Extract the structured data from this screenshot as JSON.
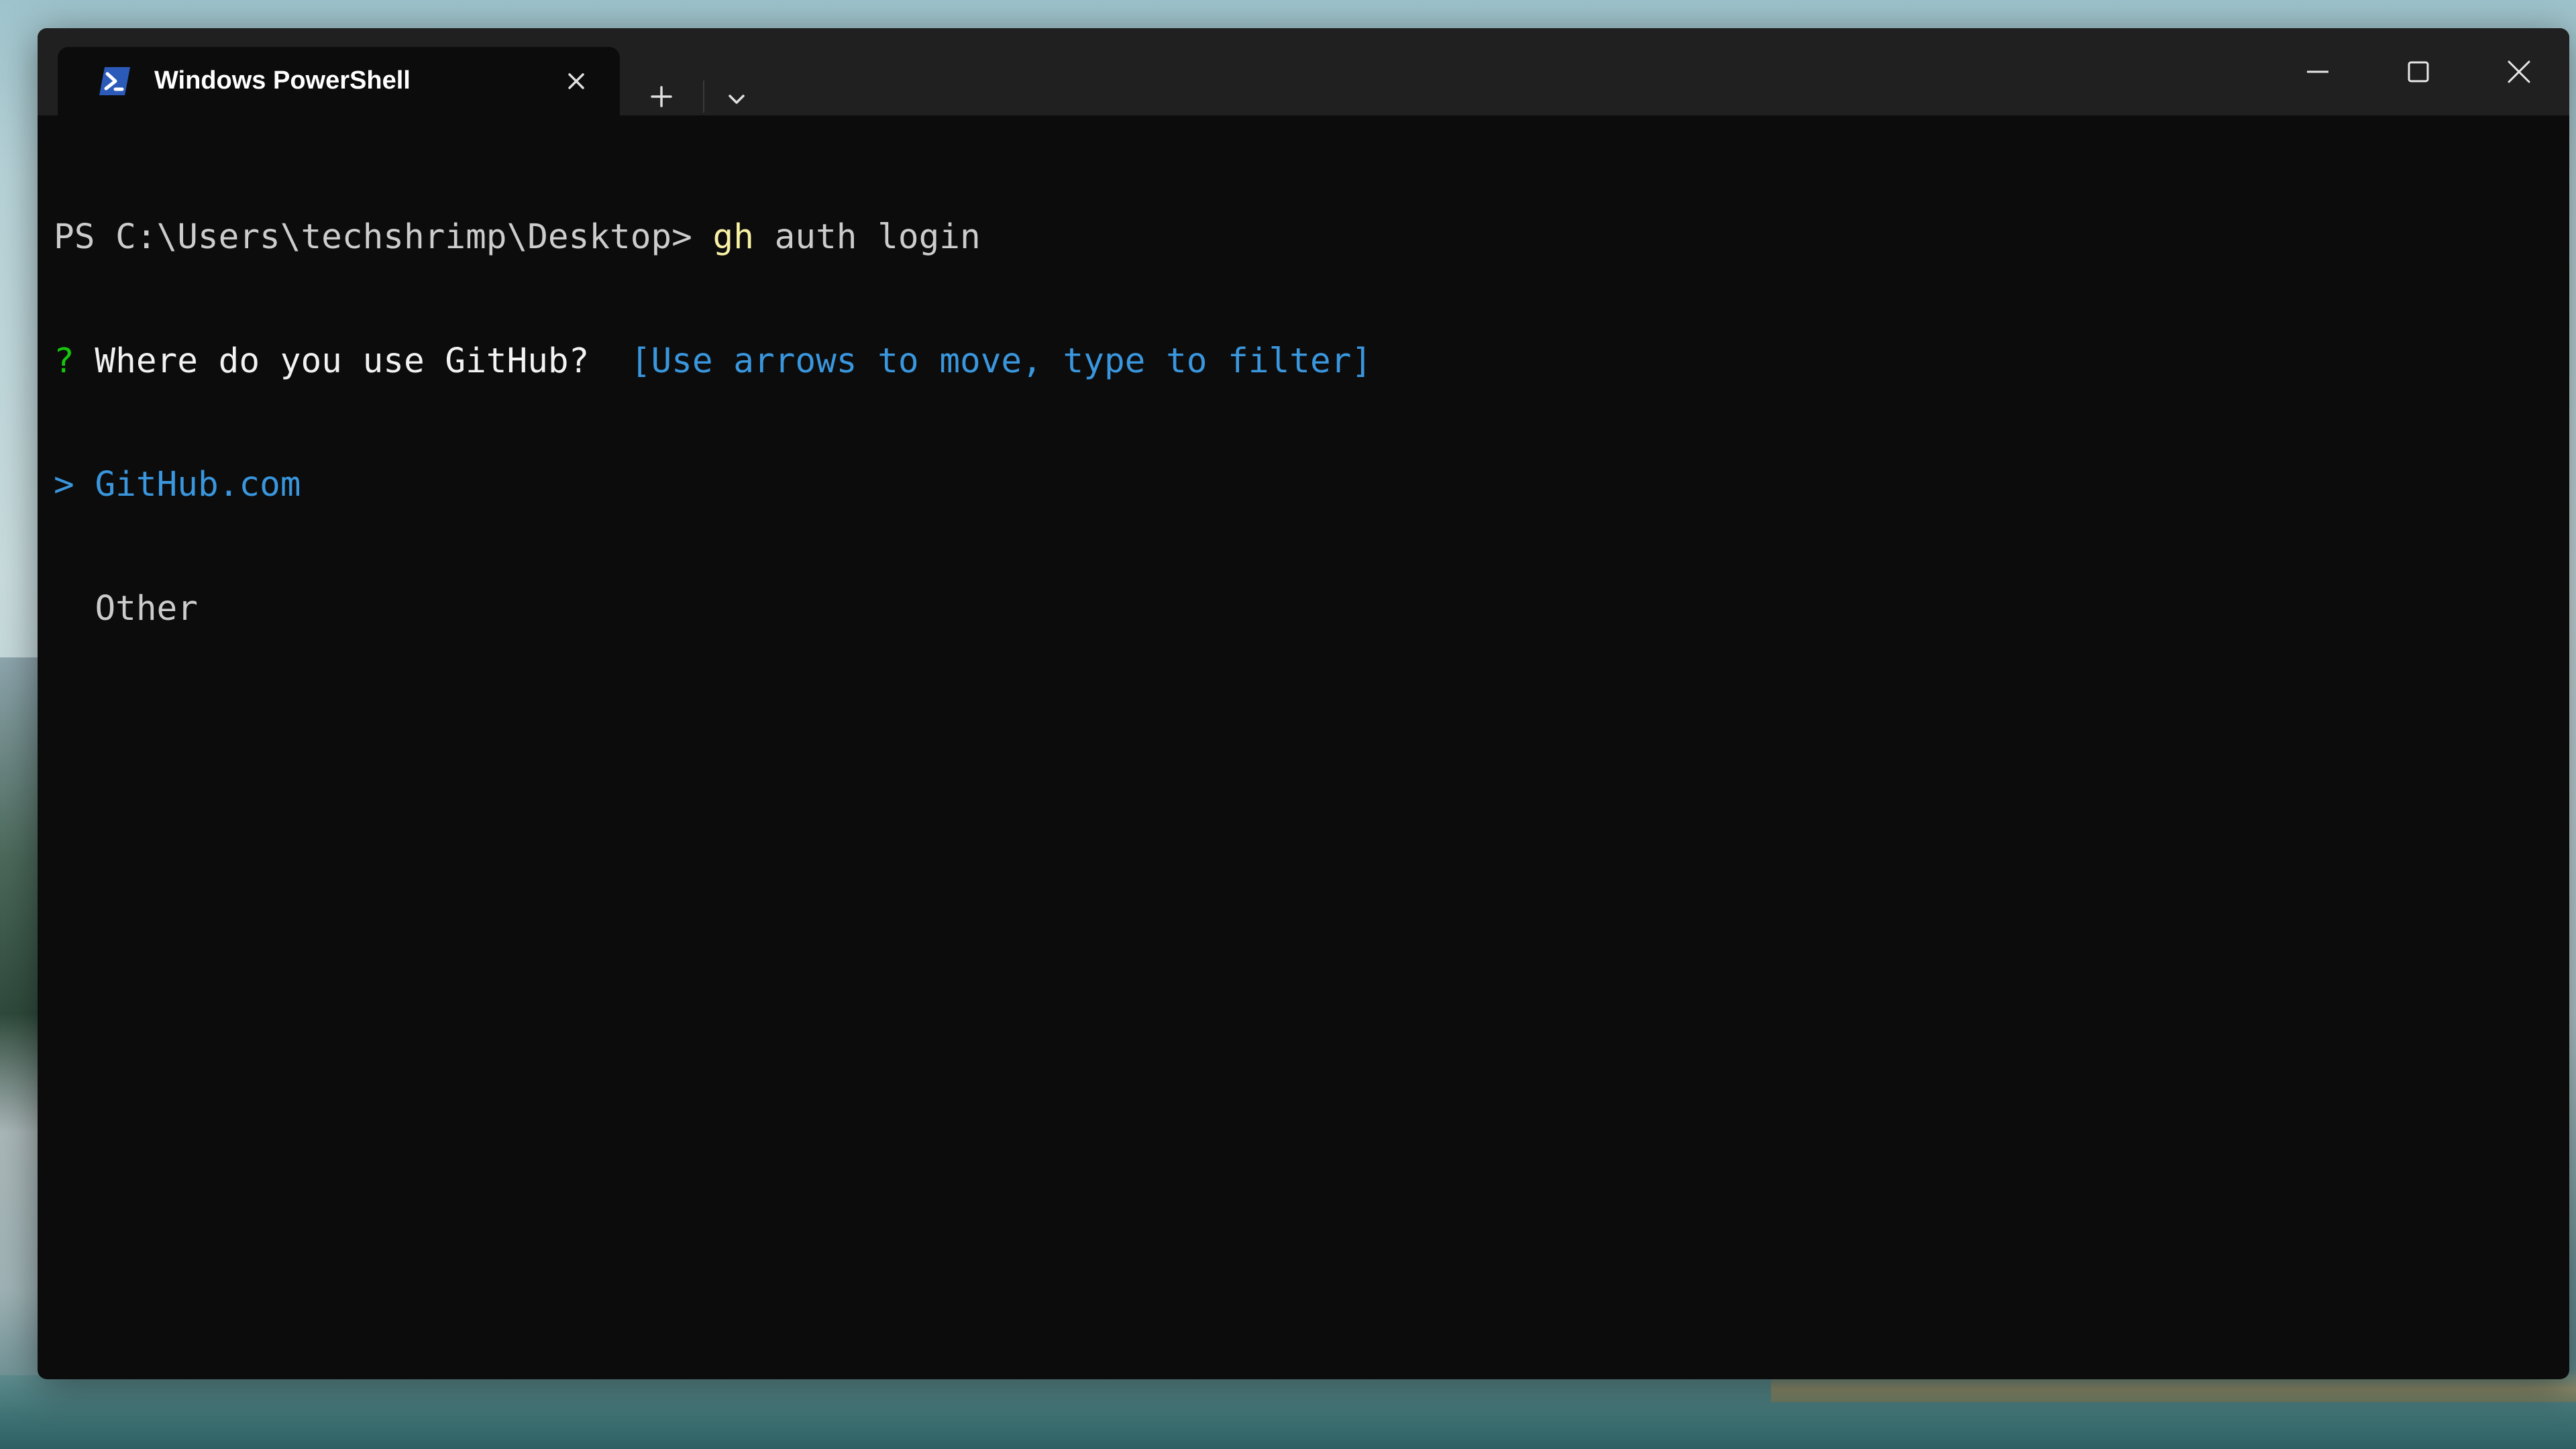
{
  "window": {
    "tab_title": "Windows PowerShell",
    "tab_icon": "powershell-icon",
    "controls": {
      "minimize": "minimize-icon",
      "maximize": "maximize-icon",
      "close": "close-icon"
    }
  },
  "terminal": {
    "prompt": "PS C:\\Users\\techshrimp\\Desktop> ",
    "command": "gh",
    "args": " auth login",
    "question_mark": "?",
    "question": " Where do you use GitHub? ",
    "hint": " [Use arrows to move, type to filter]",
    "options": [
      {
        "marker": ">",
        "label": "GitHub.com",
        "selected": true
      },
      {
        "marker": " ",
        "label": "Other",
        "selected": false
      }
    ]
  },
  "colors": {
    "terminal_bg": "#0c0c0c",
    "titlebar_bg": "#202020",
    "command": "#f9f1a5",
    "question_mark": "#16c60c",
    "hint": "#3a96dd",
    "selected_option": "#3a96dd",
    "text": "#cccccc"
  }
}
